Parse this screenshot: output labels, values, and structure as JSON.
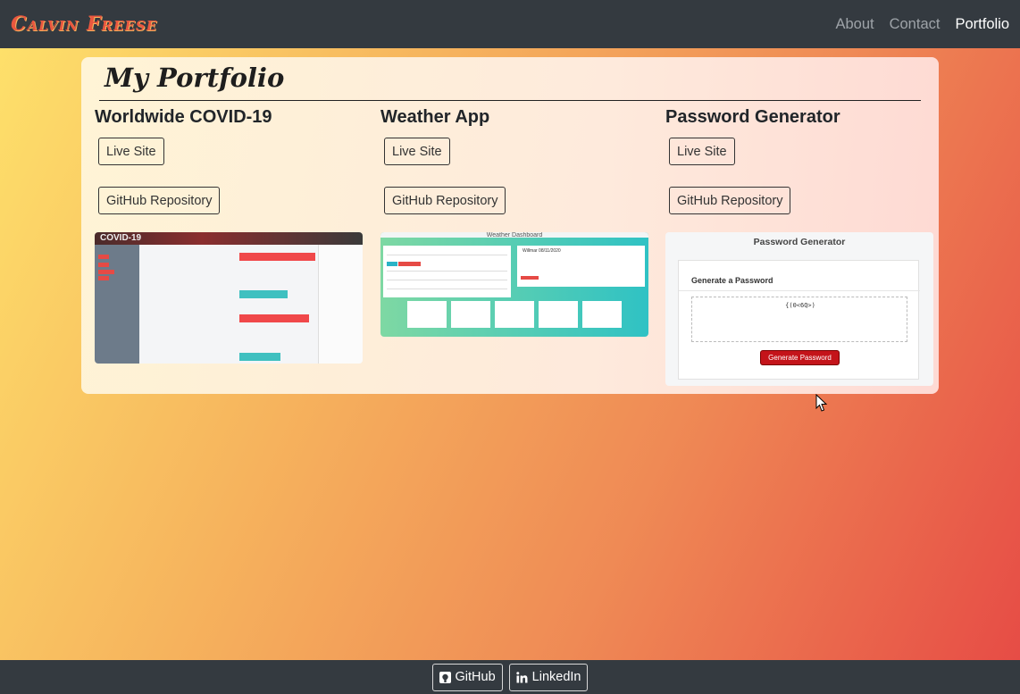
{
  "navbar": {
    "brand": "Calvin Freese",
    "links": [
      {
        "label": "About",
        "active": false
      },
      {
        "label": "Contact",
        "active": false
      },
      {
        "label": "Portfolio",
        "active": true
      }
    ]
  },
  "portfolio": {
    "title": "My Portfolio",
    "projects": [
      {
        "title": "Worldwide COVID-19",
        "live_label": "Live Site",
        "repo_label": "GitHub Repository",
        "thumb_logo": "COVID-19"
      },
      {
        "title": "Weather App",
        "live_label": "Live Site",
        "repo_label": "GitHub Repository",
        "thumb_title": "Weather Dashboard",
        "thumb_city": "Willmar 08/11/2020"
      },
      {
        "title": "Password Generator",
        "live_label": "Live Site",
        "repo_label": "GitHub Repository",
        "thumb_title": "Password Generator",
        "thumb_heading": "Generate a Password",
        "thumb_password": "{(0<6Q>)",
        "thumb_button": "Generate Password"
      }
    ]
  },
  "footer": {
    "github_label": "GitHub",
    "github_icon": "github-icon",
    "linkedin_label": "LinkedIn",
    "linkedin_icon": "linkedin-icon"
  },
  "colors": {
    "navbar": "#343a40",
    "brand": "#e9573f",
    "gradient_start": "#fee26b",
    "gradient_end": "#e64a45"
  }
}
